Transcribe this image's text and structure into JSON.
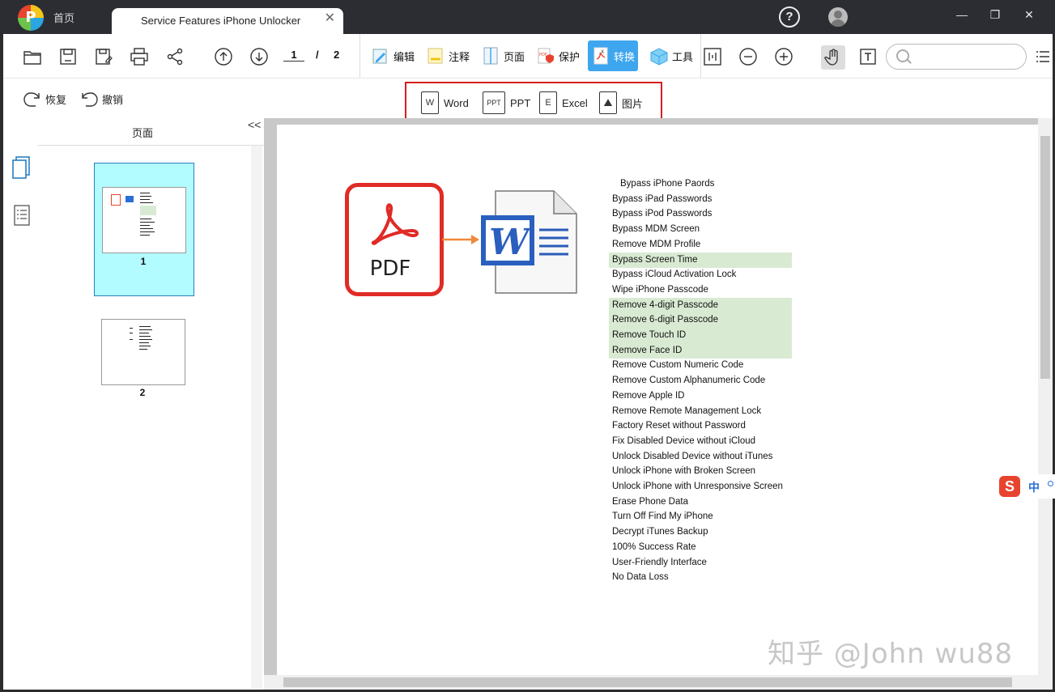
{
  "window": {
    "home_tab": "首页",
    "doc_tab_title": "Service Features iPhone Unlocker",
    "controls": [
      "—",
      "❐",
      "✕"
    ]
  },
  "toolbar": {
    "page_current": "1",
    "page_separator": "/",
    "page_total": "2",
    "ribbon": [
      {
        "label": "编辑",
        "icon": "edit-icon"
      },
      {
        "label": "注释",
        "icon": "annotate-icon"
      },
      {
        "label": "页面",
        "icon": "page-icon"
      },
      {
        "label": "保护",
        "icon": "protect-icon"
      },
      {
        "label": "转换",
        "icon": "convert-icon",
        "active": true
      },
      {
        "label": "工具",
        "icon": "tools-icon"
      }
    ],
    "search_placeholder": ""
  },
  "subtoolbar": {
    "redo": "恢复",
    "undo": "撤销",
    "convert_options": [
      "Word",
      "PPT",
      "Excel",
      "图片"
    ]
  },
  "sidebar": {
    "title": "页面",
    "collapse": "<<",
    "pages": [
      "1",
      "2"
    ]
  },
  "document": {
    "pdf_label": "PDF",
    "features": [
      "Bypass iPhone Paords",
      "Bypass iPad Passwords",
      "Bypass iPod Passwords",
      "Bypass MDM Screen",
      "Remove MDM Profile",
      "Bypass Screen Time",
      "Bypass iCloud Activation Lock",
      "Wipe iPhone Passcode",
      "Remove 4-digit Passcode",
      "Remove 6-digit Passcode",
      "Remove Touch ID",
      "Remove Face ID",
      "Remove Custom Numeric Code",
      "Remove Custom Alphanumeric Code",
      "Remove Apple ID",
      "Remove Remote Management Lock",
      "Factory Reset without Password",
      "Fix Disabled Device without iCloud",
      "Unlock Disabled Device without iTunes",
      "Unlock iPhone with Broken Screen",
      "Unlock iPhone with Unresponsive Screen",
      "Erase Phone Data",
      "Turn Off Find My iPhone",
      "Decrypt iTunes Backup",
      "100% Success Rate",
      "User-Friendly Interface",
      "No Data Loss"
    ],
    "highlighted": [
      5,
      8,
      9,
      10,
      11
    ]
  },
  "overlay": {
    "watermark": "知乎 @John wu88",
    "ime_label": "中"
  },
  "colors": {
    "accent": "#3ea6ee",
    "highlight": "#d9ead3",
    "annotation_red": "#d61e1e",
    "thumb_selected": "#b2fbff"
  }
}
